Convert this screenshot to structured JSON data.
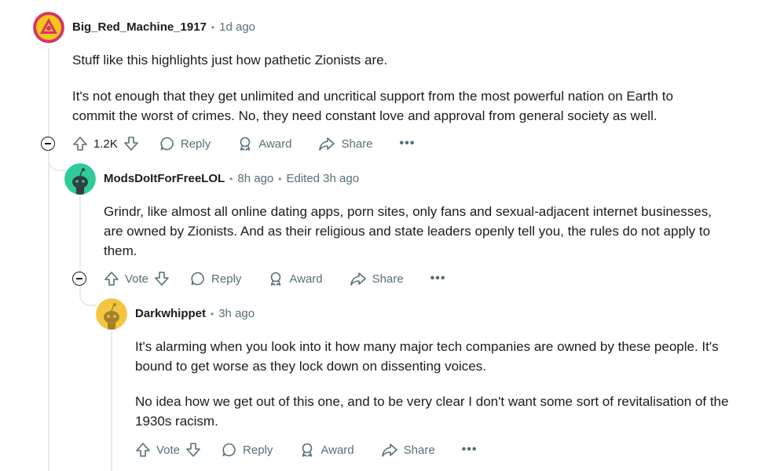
{
  "comments": [
    {
      "username": "Big_Red_Machine_1917",
      "time": "1d ago",
      "paragraphs": [
        "Stuff like this highlights just how pathetic Zionists are.",
        "It's not enough that they get unlimited and uncritical support from the most powerful nation on Earth to commit the worst of crimes. No, they need constant love and approval from general society as well."
      ],
      "vote_label": "1.2K",
      "reply_label": "Reply",
      "award_label": "Award",
      "share_label": "Share",
      "more_label": "•••"
    },
    {
      "username": "ModsDoItForFreeLOL",
      "time": "8h ago",
      "edited": "Edited 3h ago",
      "paragraphs": [
        "Grindr, like almost all online dating apps, porn sites, only fans and sexual-adjacent internet businesses, are owned by Zionists. And as their religious and state leaders openly tell you, the rules do not apply to them."
      ],
      "vote_label": "Vote",
      "reply_label": "Reply",
      "award_label": "Award",
      "share_label": "Share",
      "more_label": "•••"
    },
    {
      "username": "Darkwhippet",
      "time": "3h ago",
      "paragraphs": [
        "It's alarming when you look into it how many major tech companies are owned by these people. It's bound to get worse as they lock down on dissenting voices.",
        "No idea how we get out of this one, and to be very clear I don't want some sort of revitalisation of the 1930s racism."
      ],
      "vote_label": "Vote",
      "reply_label": "Reply",
      "award_label": "Award",
      "share_label": "Share",
      "more_label": "•••"
    }
  ],
  "separator": "•",
  "colors": {
    "text": "#1c1c1c",
    "meta": "#576f76",
    "thread_line": "#e5ebee",
    "avatar1_bg": "#d6336c",
    "avatar1_inner": "#f5c518",
    "avatar2_bg": "#2ecc9a",
    "avatar3_bg": "#f5c542"
  },
  "icons": [
    "upvote-icon",
    "downvote-icon",
    "reply-bubble-icon",
    "award-icon",
    "share-icon",
    "collapse-icon"
  ]
}
